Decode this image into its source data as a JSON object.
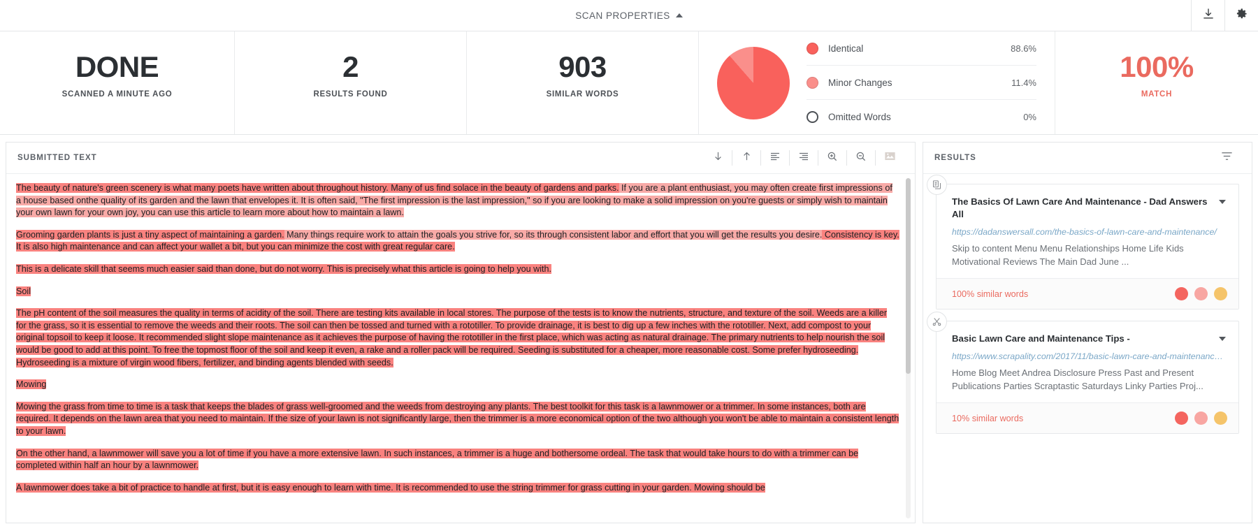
{
  "topbar": {
    "title": "SCAN PROPERTIES",
    "collapse_icon": "chevron-up-icon",
    "download_icon": "download-icon",
    "settings_icon": "gear-icon"
  },
  "stats": {
    "status_value": "DONE",
    "status_label": "SCANNED A MINUTE AGO",
    "results_value": "2",
    "results_label": "RESULTS FOUND",
    "words_value": "903",
    "words_label": "SIMILAR WORDS",
    "match_value": "100%",
    "match_label": "MATCH",
    "match_color": "#ea6a5f"
  },
  "chart_data": {
    "type": "pie",
    "title": "",
    "categories": [
      "Identical",
      "Minor Changes",
      "Omitted Words"
    ],
    "values": [
      88.6,
      11.4,
      0
    ],
    "value_labels": [
      "88.6%",
      "11.4%",
      "0%"
    ],
    "colors": [
      "#f9615c",
      "#fa8f8b",
      "#ffffff"
    ],
    "legend": "right",
    "unit": "%"
  },
  "submitted": {
    "title": "SUBMITTED TEXT",
    "toolbar": [
      {
        "name": "scroll-down-icon",
        "label": "Next match"
      },
      {
        "name": "scroll-up-icon",
        "label": "Previous match"
      },
      {
        "name": "align-left-icon",
        "label": "Align left"
      },
      {
        "name": "align-right-icon",
        "label": "Align right"
      },
      {
        "name": "zoom-in-icon",
        "label": "Zoom in"
      },
      {
        "name": "zoom-out-icon",
        "label": "Zoom out"
      },
      {
        "name": "image-icon",
        "label": "Image view"
      }
    ],
    "paragraphs": [
      [
        {
          "t": "The beauty of nature's green scenery is what many poets have written about throughout history. Many of us find solace in the beauty of gardens and parks.",
          "h": "strong"
        },
        {
          "t": " If you are a plant enthusiast, you may often create first impressions of a house based onthe quality of its garden and the lawn that envelopes it. It is often said, \"The first impression is the last impression,\" so if you are looking to make a solid impression on you're guests or simply wish to maintain your own lawn for your own joy, you can use this article to learn more about how to maintain a lawn.",
          "h": "light"
        }
      ],
      [
        {
          "t": "Grooming garden plants is just a tiny aspect of maintaining a garden.",
          "h": "strong"
        },
        {
          "t": " Many things require work to attain the goals you strive for, so its through consistent labor and effort that you will get the results you desire.",
          "h": "light"
        },
        {
          "t": " Consistency is key. It is also high maintenance and can affect your wallet a bit, but you can minimize the cost with great regular care.",
          "h": "strong"
        }
      ],
      [
        {
          "t": "This is a delicate skill that seems much easier said than done, but do not worry. This is precisely what this article is going to help you with.",
          "h": "strong"
        }
      ],
      [
        {
          "t": "Soil",
          "h": "strong"
        }
      ],
      [
        {
          "t": "The pH content of the soil measures the quality in terms of acidity of the soil. There are testing kits available in local stores. The purpose of the tests is to know the nutrients, structure, and texture of the soil. Weeds are a killer for the grass, so it is essential to remove the weeds and their roots. The soil can then be tossed and turned with a rototiller. To provide drainage, it is best to dig up a few inches with the rototiller. Next, add compost to your original topsoil to keep it loose. It recommended slight slope maintenance as it achieves the purpose of having the rototiller in the first place, which was acting as natural drainage. The primary nutrients to help nourish the soil would be good to add at this point. To free the topmost floor of the soil and keep it even, a rake and a roller pack will be required. Seeding is substituted for a cheaper, more reasonable cost. Some prefer hydroseeding. Hydroseeding is a mixture of virgin wood fibers, fertilizer, and binding agents blended with seeds.",
          "h": "strong"
        }
      ],
      [
        {
          "t": "Mowing",
          "h": "strong"
        }
      ],
      [
        {
          "t": "Mowing the grass from time to time is a task that keeps the blades of grass well-groomed and the weeds from destroying any plants. The best toolkit for this task is a lawnmower or a trimmer. In some instances, both are required. It depends on the lawn area that you need to maintain. If the size of your lawn is not significantly large, then the trimmer is a more economical option of the two although you won't be able to maintain a consistent length to your lawn.",
          "h": "strong"
        }
      ],
      [
        {
          "t": "On the other hand, a lawnmower will save you a lot of time if you have a more extensive lawn. In such instances, a trimmer is a huge and bothersome ordeal. The task that would take hours to do with a trimmer can be completed within half an hour by a lawnmower.",
          "h": "strong"
        }
      ],
      [
        {
          "t": "A lawnmower does take a bit of practice to handle at first, but it is easy enough to learn with time. It is recommended to use the string trimmer for grass cutting in your garden. Mowing should be",
          "h": "strong"
        }
      ]
    ]
  },
  "results": {
    "title": "RESULTS",
    "filter_icon": "filter-icon",
    "cards": [
      {
        "badge_icon": "copy-icon",
        "title": "The Basics Of Lawn Care And Maintenance - Dad Answers All",
        "url": "https://dadanswersall.com/the-basics-of-lawn-care-and-maintenance/",
        "snippet": "Skip to content Menu Menu Relationships Home Life Kids Motivational Reviews The Main Dad June ...",
        "similar": "100% similar words",
        "dot_colors": [
          "#f4655f",
          "#f8a6a2",
          "#f5c46a"
        ],
        "caret_icon": "chevron-down-icon"
      },
      {
        "badge_icon": "scissors-icon",
        "title": "Basic Lawn Care and Maintenance Tips -",
        "url": "https://www.scrapality.com/2017/11/basic-lawn-care-and-maintenance-t...",
        "snippet": "Home Blog Meet Andrea Disclosure Press Past and Present Publications Parties Scraptastic Saturdays Linky Parties Proj...",
        "similar": "10% similar words",
        "dot_colors": [
          "#f4655f",
          "#f8a6a2",
          "#f5c46a"
        ],
        "caret_icon": "chevron-down-icon"
      }
    ]
  }
}
